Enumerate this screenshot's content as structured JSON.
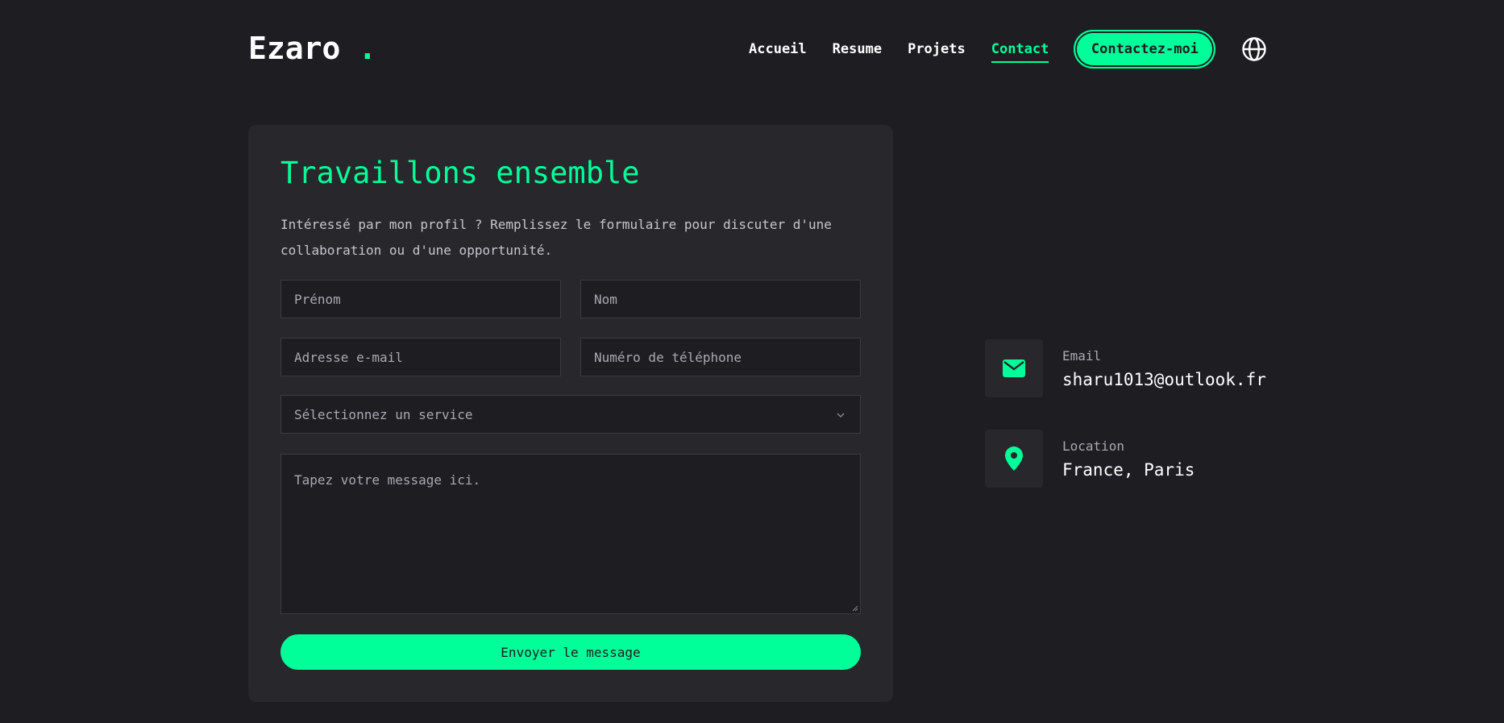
{
  "brand": {
    "name": "Ezaro",
    "dot": ".",
    "accent_color": "#00ff99",
    "background_color": "#1d1d22",
    "card_color": "#27272c"
  },
  "nav": {
    "items": [
      {
        "label": "Accueil",
        "active": false
      },
      {
        "label": "Resume",
        "active": false
      },
      {
        "label": "Projets",
        "active": false
      },
      {
        "label": "Contact",
        "active": true
      }
    ],
    "cta_label": "Contactez-moi",
    "language_icon": "globe-icon"
  },
  "contact_form": {
    "title": "Travaillons ensemble",
    "description": "Intéressé par mon profil ? Remplissez le formulaire pour discuter d'une collaboration ou d'une opportunité.",
    "fields": {
      "first_name_placeholder": "Prénom",
      "last_name_placeholder": "Nom",
      "email_placeholder": "Adresse e-mail",
      "phone_placeholder": "Numéro de téléphone",
      "service_placeholder": "Sélectionnez un service",
      "message_placeholder": "Tapez votre message ici."
    },
    "submit_label": "Envoyer le message"
  },
  "contact_info": {
    "email": {
      "label": "Email",
      "value": "sharu1013@outlook.fr",
      "icon": "envelope-icon"
    },
    "location": {
      "label": "Location",
      "value": "France, Paris",
      "icon": "map-pin-icon"
    }
  }
}
